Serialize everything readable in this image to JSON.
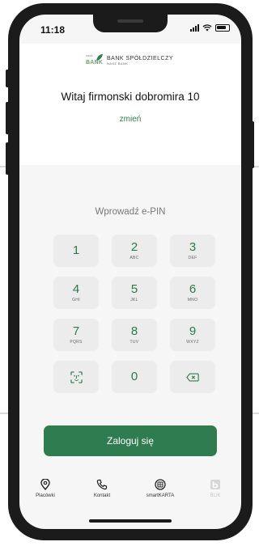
{
  "status_bar": {
    "time": "11:18"
  },
  "bank": {
    "name": "BANK SPÓŁDZIELCZY",
    "subtitle": "NASZ BANK",
    "logo_small_text": "nasz",
    "logo_big_text": "BANK"
  },
  "greeting": "Witaj firmonski dobromira 10",
  "change_link": "zmień",
  "pin": {
    "prompt": "Wprowadź e-PIN"
  },
  "keypad": [
    {
      "num": "1",
      "letters": ""
    },
    {
      "num": "2",
      "letters": "ABC"
    },
    {
      "num": "3",
      "letters": "DEF"
    },
    {
      "num": "4",
      "letters": "GHI"
    },
    {
      "num": "5",
      "letters": "JKL"
    },
    {
      "num": "6",
      "letters": "MNO"
    },
    {
      "num": "7",
      "letters": "PQRS"
    },
    {
      "num": "8",
      "letters": "TUV"
    },
    {
      "num": "9",
      "letters": "WXYZ"
    },
    {
      "num": "0",
      "letters": ""
    }
  ],
  "keypad_icons": {
    "biometric": "face-id-icon",
    "delete": "backspace-icon"
  },
  "login_button": "Zaloguj się",
  "nav": [
    {
      "label": "Placówki",
      "icon": "location-pin-icon",
      "muted": false
    },
    {
      "label": "Kontakt",
      "icon": "phone-icon",
      "muted": false
    },
    {
      "label": "smartKARTA",
      "icon": "smartkarta-icon",
      "muted": false
    },
    {
      "label": "BLIK",
      "icon": "blik-icon",
      "muted": true
    }
  ],
  "colors": {
    "accent": "#2e7c4f",
    "accent_text": "#2b7a4b",
    "key_bg": "#ececec",
    "phone": "#1b1b1b"
  }
}
